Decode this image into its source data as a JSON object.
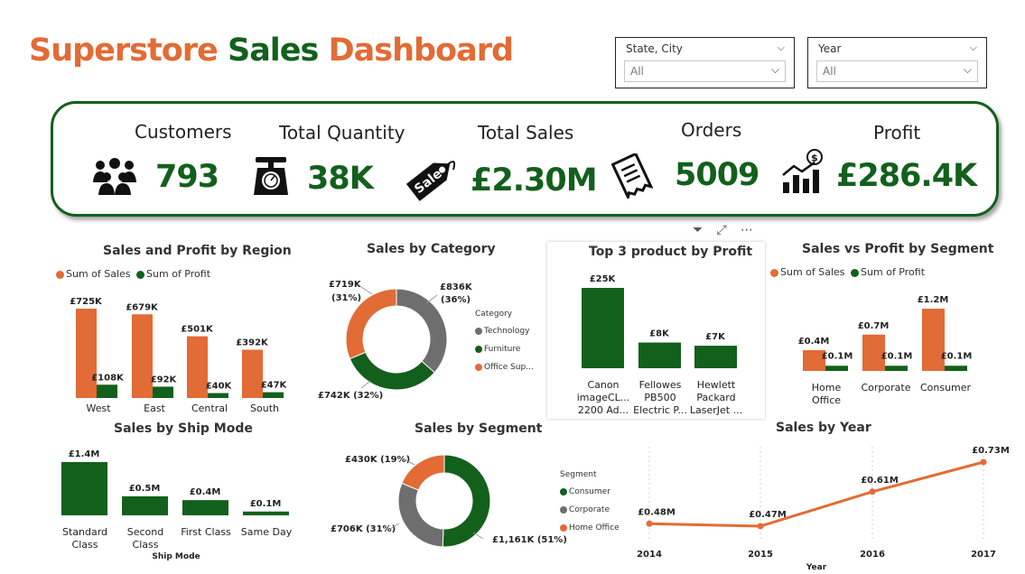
{
  "title": {
    "part1": "Superstore",
    "part2": "Sales",
    "part3": "Dashboard"
  },
  "slicers": [
    {
      "label": "State, City",
      "value": "All"
    },
    {
      "label": "Year",
      "value": "All"
    }
  ],
  "kpis": [
    {
      "label": "Customers",
      "value": "793",
      "icon": "people-icon"
    },
    {
      "label": "Total Quantity",
      "value": "38K",
      "icon": "scale-icon"
    },
    {
      "label": "Total Sales",
      "value": "£2.30M",
      "icon": "sale-tag-icon"
    },
    {
      "label": "Orders",
      "value": "5009",
      "icon": "receipt-icon"
    },
    {
      "label": "Profit",
      "value": "£286.4K",
      "icon": "profit-growth-icon"
    }
  ],
  "colors": {
    "orange": "#e36b35",
    "green": "#12601c",
    "gray": "#6e6e6e"
  },
  "toolbar": {
    "filter": "filter-icon",
    "focus": "focus-mode-icon",
    "more": "more-options-icon"
  },
  "chart_data": [
    {
      "id": "region",
      "type": "bar",
      "title": "Sales and Profit by Region",
      "categories": [
        "West",
        "East",
        "Central",
        "South"
      ],
      "series": [
        {
          "name": "Sum of Sales",
          "values": [
            725,
            679,
            501,
            392
          ],
          "labels": [
            "£725K",
            "£679K",
            "£501K",
            "£392K"
          ]
        },
        {
          "name": "Sum of Profit",
          "values": [
            108,
            92,
            40,
            47
          ],
          "labels": [
            "£108K",
            "£92K",
            "£40K",
            "£47K"
          ]
        }
      ],
      "legend": "top-left"
    },
    {
      "id": "category",
      "type": "pie",
      "title": "Sales by Category",
      "legend_title": "Category",
      "slices": [
        {
          "name": "Technology",
          "value": 836,
          "label": "£836K",
          "pct": "(36%)"
        },
        {
          "name": "Furniture",
          "value": 742,
          "label": "£742K (32%)",
          "pct": ""
        },
        {
          "name": "Office Sup...",
          "value": 719,
          "label": "£719K",
          "pct": "(31%)"
        }
      ],
      "legend": "right"
    },
    {
      "id": "top3",
      "type": "bar",
      "title": "Top 3 product by Profit",
      "categories": [
        [
          "Canon",
          "imageCL...",
          "2200 Ad..."
        ],
        [
          "Fellowes",
          "PB500",
          "Electric P..."
        ],
        [
          "Hewlett",
          "Packard",
          "LaserJet ..."
        ]
      ],
      "values": [
        25,
        8,
        7
      ],
      "labels": [
        "£25K",
        "£8K",
        "£7K"
      ]
    },
    {
      "id": "segment_bar",
      "type": "bar",
      "title": "Sales vs Profit by Segment",
      "categories": [
        [
          "Home",
          "Office"
        ],
        [
          "Corporate"
        ],
        [
          "Consumer"
        ]
      ],
      "series": [
        {
          "name": "Sum of Sales",
          "values": [
            0.4,
            0.7,
            1.2
          ],
          "labels": [
            "£0.4M",
            "£0.7M",
            "£1.2M"
          ]
        },
        {
          "name": "Sum of Profit",
          "values": [
            0.1,
            0.1,
            0.1
          ],
          "labels": [
            "£0.1M",
            "£0.1M",
            "£0.1M"
          ]
        }
      ],
      "legend": "top-left"
    },
    {
      "id": "shipmode",
      "type": "bar",
      "title": "Sales by Ship Mode",
      "xlabel": "Ship Mode",
      "categories": [
        [
          "Standard",
          "Class"
        ],
        [
          "Second",
          "Class"
        ],
        [
          "First Class"
        ],
        [
          "Same Day"
        ]
      ],
      "values": [
        1.4,
        0.5,
        0.4,
        0.1
      ],
      "labels": [
        "£1.4M",
        "£0.5M",
        "£0.4M",
        "£0.1M"
      ]
    },
    {
      "id": "segment_pie",
      "type": "pie",
      "title": "Sales by Segment",
      "legend_title": "Segment",
      "slices": [
        {
          "name": "Consumer",
          "value": 1161,
          "label": "£1,161K (51%)"
        },
        {
          "name": "Corporate",
          "value": 706,
          "label": "£706K (31%)"
        },
        {
          "name": "Home Office",
          "value": 430,
          "label": "£430K (19%)"
        }
      ],
      "legend": "right"
    },
    {
      "id": "year",
      "type": "line",
      "title": "Sales by Year",
      "xlabel": "Year",
      "x": [
        "2014",
        "2015",
        "2016",
        "2017"
      ],
      "values": [
        0.48,
        0.47,
        0.61,
        0.73
      ],
      "labels": [
        "£0.48M",
        "£0.47M",
        "£0.61M",
        "£0.73M"
      ]
    }
  ]
}
